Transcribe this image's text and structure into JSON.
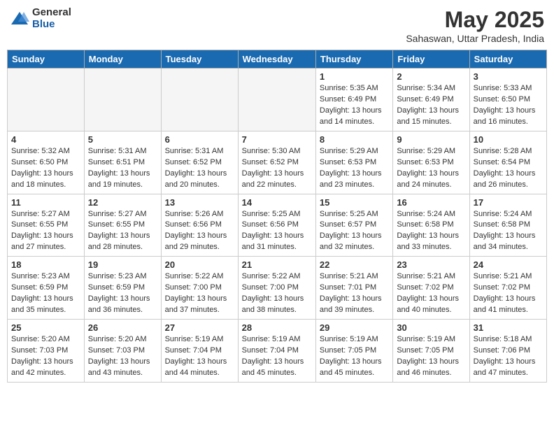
{
  "header": {
    "logo_general": "General",
    "logo_blue": "Blue",
    "month_year": "May 2025",
    "location": "Sahaswan, Uttar Pradesh, India"
  },
  "weekdays": [
    "Sunday",
    "Monday",
    "Tuesday",
    "Wednesday",
    "Thursday",
    "Friday",
    "Saturday"
  ],
  "weeks": [
    [
      {
        "day": "",
        "info": ""
      },
      {
        "day": "",
        "info": ""
      },
      {
        "day": "",
        "info": ""
      },
      {
        "day": "",
        "info": ""
      },
      {
        "day": "1",
        "info": "Sunrise: 5:35 AM\nSunset: 6:49 PM\nDaylight: 13 hours\nand 14 minutes."
      },
      {
        "day": "2",
        "info": "Sunrise: 5:34 AM\nSunset: 6:49 PM\nDaylight: 13 hours\nand 15 minutes."
      },
      {
        "day": "3",
        "info": "Sunrise: 5:33 AM\nSunset: 6:50 PM\nDaylight: 13 hours\nand 16 minutes."
      }
    ],
    [
      {
        "day": "4",
        "info": "Sunrise: 5:32 AM\nSunset: 6:50 PM\nDaylight: 13 hours\nand 18 minutes."
      },
      {
        "day": "5",
        "info": "Sunrise: 5:31 AM\nSunset: 6:51 PM\nDaylight: 13 hours\nand 19 minutes."
      },
      {
        "day": "6",
        "info": "Sunrise: 5:31 AM\nSunset: 6:52 PM\nDaylight: 13 hours\nand 20 minutes."
      },
      {
        "day": "7",
        "info": "Sunrise: 5:30 AM\nSunset: 6:52 PM\nDaylight: 13 hours\nand 22 minutes."
      },
      {
        "day": "8",
        "info": "Sunrise: 5:29 AM\nSunset: 6:53 PM\nDaylight: 13 hours\nand 23 minutes."
      },
      {
        "day": "9",
        "info": "Sunrise: 5:29 AM\nSunset: 6:53 PM\nDaylight: 13 hours\nand 24 minutes."
      },
      {
        "day": "10",
        "info": "Sunrise: 5:28 AM\nSunset: 6:54 PM\nDaylight: 13 hours\nand 26 minutes."
      }
    ],
    [
      {
        "day": "11",
        "info": "Sunrise: 5:27 AM\nSunset: 6:55 PM\nDaylight: 13 hours\nand 27 minutes."
      },
      {
        "day": "12",
        "info": "Sunrise: 5:27 AM\nSunset: 6:55 PM\nDaylight: 13 hours\nand 28 minutes."
      },
      {
        "day": "13",
        "info": "Sunrise: 5:26 AM\nSunset: 6:56 PM\nDaylight: 13 hours\nand 29 minutes."
      },
      {
        "day": "14",
        "info": "Sunrise: 5:25 AM\nSunset: 6:56 PM\nDaylight: 13 hours\nand 31 minutes."
      },
      {
        "day": "15",
        "info": "Sunrise: 5:25 AM\nSunset: 6:57 PM\nDaylight: 13 hours\nand 32 minutes."
      },
      {
        "day": "16",
        "info": "Sunrise: 5:24 AM\nSunset: 6:58 PM\nDaylight: 13 hours\nand 33 minutes."
      },
      {
        "day": "17",
        "info": "Sunrise: 5:24 AM\nSunset: 6:58 PM\nDaylight: 13 hours\nand 34 minutes."
      }
    ],
    [
      {
        "day": "18",
        "info": "Sunrise: 5:23 AM\nSunset: 6:59 PM\nDaylight: 13 hours\nand 35 minutes."
      },
      {
        "day": "19",
        "info": "Sunrise: 5:23 AM\nSunset: 6:59 PM\nDaylight: 13 hours\nand 36 minutes."
      },
      {
        "day": "20",
        "info": "Sunrise: 5:22 AM\nSunset: 7:00 PM\nDaylight: 13 hours\nand 37 minutes."
      },
      {
        "day": "21",
        "info": "Sunrise: 5:22 AM\nSunset: 7:00 PM\nDaylight: 13 hours\nand 38 minutes."
      },
      {
        "day": "22",
        "info": "Sunrise: 5:21 AM\nSunset: 7:01 PM\nDaylight: 13 hours\nand 39 minutes."
      },
      {
        "day": "23",
        "info": "Sunrise: 5:21 AM\nSunset: 7:02 PM\nDaylight: 13 hours\nand 40 minutes."
      },
      {
        "day": "24",
        "info": "Sunrise: 5:21 AM\nSunset: 7:02 PM\nDaylight: 13 hours\nand 41 minutes."
      }
    ],
    [
      {
        "day": "25",
        "info": "Sunrise: 5:20 AM\nSunset: 7:03 PM\nDaylight: 13 hours\nand 42 minutes."
      },
      {
        "day": "26",
        "info": "Sunrise: 5:20 AM\nSunset: 7:03 PM\nDaylight: 13 hours\nand 43 minutes."
      },
      {
        "day": "27",
        "info": "Sunrise: 5:19 AM\nSunset: 7:04 PM\nDaylight: 13 hours\nand 44 minutes."
      },
      {
        "day": "28",
        "info": "Sunrise: 5:19 AM\nSunset: 7:04 PM\nDaylight: 13 hours\nand 45 minutes."
      },
      {
        "day": "29",
        "info": "Sunrise: 5:19 AM\nSunset: 7:05 PM\nDaylight: 13 hours\nand 45 minutes."
      },
      {
        "day": "30",
        "info": "Sunrise: 5:19 AM\nSunset: 7:05 PM\nDaylight: 13 hours\nand 46 minutes."
      },
      {
        "day": "31",
        "info": "Sunrise: 5:18 AM\nSunset: 7:06 PM\nDaylight: 13 hours\nand 47 minutes."
      }
    ]
  ]
}
